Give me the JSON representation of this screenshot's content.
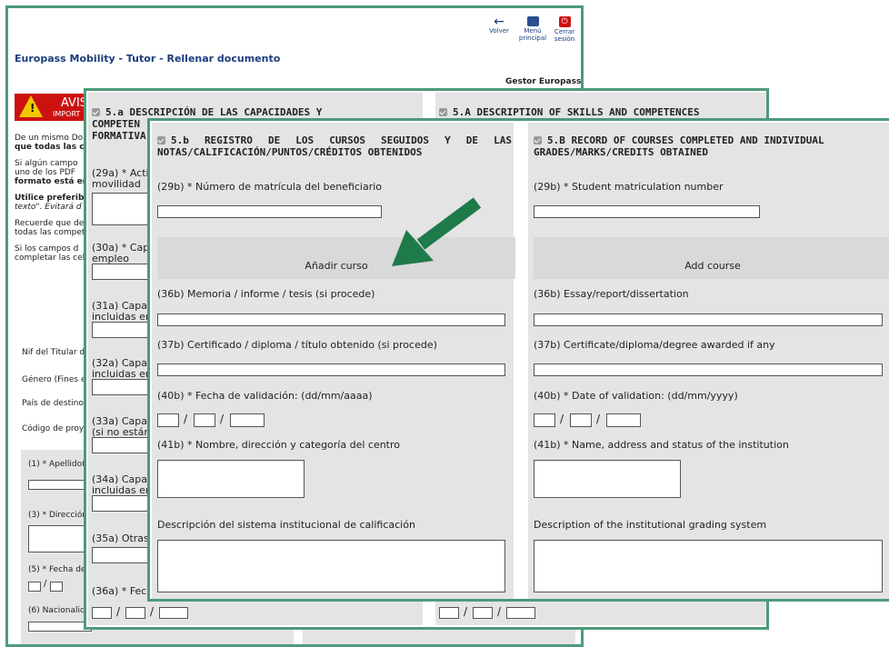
{
  "page": {
    "title": "Europass Mobility - Tutor - Rellenar documento",
    "gestor": "Gestor Europass"
  },
  "toolbar": {
    "volver": "Volver",
    "menu_1": "Menú",
    "menu_2": "principal",
    "cerrar_1": "Cerrar",
    "cerrar_2": "sesión"
  },
  "warning": {
    "title": "AVIS",
    "sub": "IMPORT"
  },
  "bg_text": {
    "p1_a": "De un mismo Do",
    "p1_b": "que todas las co",
    "p2_a": "Si algún campo",
    "p2_b": "uno de los PDF",
    "p2_c": "formato está en",
    "p3_a": "Utilice preferib",
    "p3_b": "texto\". Evitará d",
    "p4_a": "Recuerde que de",
    "p4_b": "todas las compet",
    "p5_a": "Si los campos d",
    "p5_b": "completar las cel",
    "nif": "Nif del Titular del",
    "genero": "Género (Fines est",
    "pais": "País de destino:",
    "codigo": "Código de proyect",
    "f1": "(1) * Apellido(s)",
    "f3": "(3) * Dirección",
    "f5": "(5) * Fecha de",
    "f6": "(6) Nacionalidad"
  },
  "middle": {
    "header_es_1": "5.a DESCRIPCIÓN DE LAS CAPACIDADES Y",
    "header_es_2": "COMPETEN",
    "header_es_3": "FORMATIVA",
    "header_en": "5.A DESCRIPTION OF SKILLS AND COMPETENCES",
    "f29a_1": "(29a) * Activ",
    "f29a_2": "movilidad",
    "f30a_1": "(30a) * Capa",
    "f30a_2": "empleo",
    "f31a_1": "(31a) Capaci",
    "f31a_2": "incluidas en",
    "f32a_1": "(32a) Capaci",
    "f32a_2": "incluidas en",
    "f33a_1": "(33a) Capaci",
    "f33a_2": "(si no están",
    "f34a_1": "(34a) Capaci",
    "f34a_2": "incluidas en",
    "f35a": "(35a) Otras",
    "f36a": "(36a) * Fech"
  },
  "front": {
    "es": {
      "header": "5.b REGISTRO DE LOS CURSOS SEGUIDOS Y DE LAS NOTAS/CALIFICACIÓN/PUNTOS/CRÉDITOS OBTENIDOS",
      "f29b": "(29b) * Número de matrícula del beneficiario",
      "add": "Añadir curso",
      "f36b": "(36b) Memoria / informe / tesis (si procede)",
      "f37b": "(37b) Certificado / diploma / título obtenido (si procede)",
      "f40b": "(40b) * Fecha de validación: (dd/mm/aaaa)",
      "f41b": "(41b) * Nombre, dirección y categoría del centro",
      "grading": "Descripción del sistema institucional de calificación"
    },
    "en": {
      "header": "5.B RECORD OF COURSES COMPLETED AND INDIVIDUAL GRADES/MARKS/CREDITS OBTAINED",
      "f29b": "(29b) * Student matriculation number",
      "add": "Add course",
      "f36b": "(36b) Essay/report/dissertation",
      "f37b": "(37b) Certificate/diploma/degree awarded if any",
      "f40b": "(40b) * Date of validation: (dd/mm/yyyy)",
      "f41b": "(41b) * Name, address and status of the institution",
      "grading": "Description of the institutional grading system"
    },
    "date_sep": "/"
  },
  "colors": {
    "frame": "#4e9a7a",
    "arrow": "#1f7a4a",
    "title": "#1a3c7a",
    "warning_red": "#cc1111"
  }
}
